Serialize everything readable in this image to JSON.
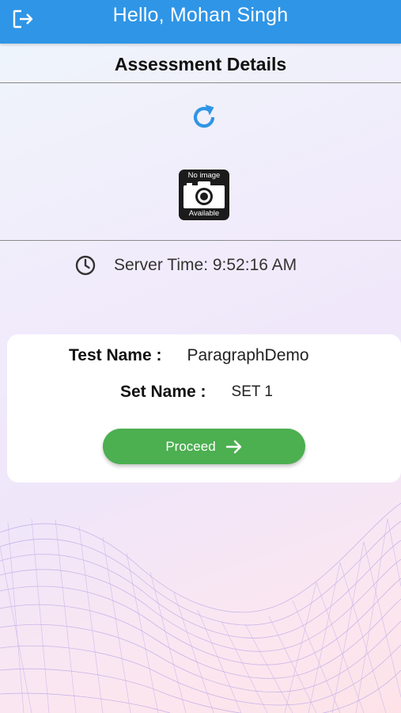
{
  "header": {
    "greeting": "Hello, Mohan Singh",
    "logout_icon": "logout-icon",
    "color": "#2f95e6"
  },
  "page": {
    "title": "Assessment Details",
    "refresh_icon": "refresh-icon",
    "placeholder_image": {
      "line1": "No image",
      "line2": "Available",
      "icon": "camera-icon"
    },
    "server_time": {
      "icon": "clock-icon",
      "text": "Server Time: 9:52:16 AM"
    }
  },
  "card": {
    "test_name_label": "Test Name :",
    "test_name_value": "ParagraphDemo",
    "set_name_label": "Set Name :",
    "set_name_value": "SET 1",
    "proceed_label": "Proceed",
    "proceed_icon": "arrow-right-icon",
    "proceed_color": "#4caf50"
  }
}
